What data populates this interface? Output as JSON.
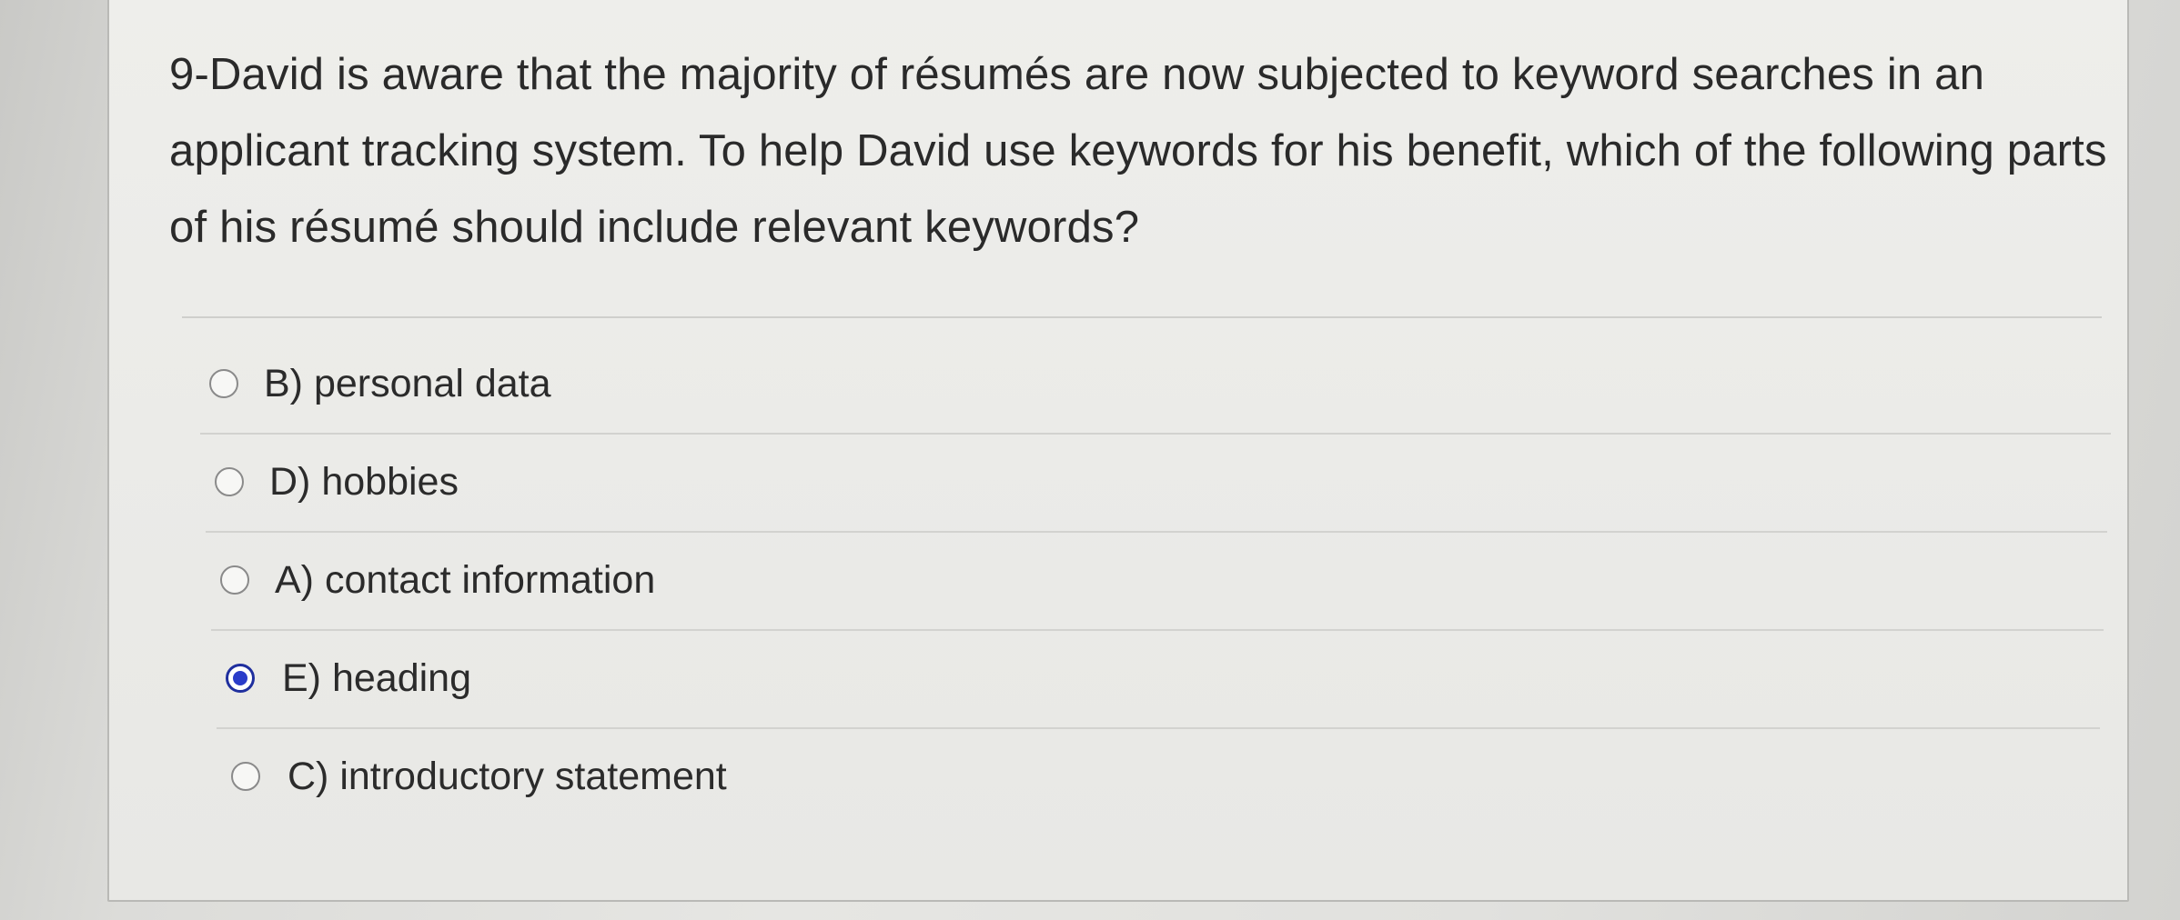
{
  "question": {
    "text": "9-David is aware that the majority of résumés are now subjected to keyword searches in an applicant tracking system. To help David use keywords for his benefit, which of the following parts of his résumé should include relevant keywords?"
  },
  "options": [
    {
      "label": "B) personal data",
      "selected": false
    },
    {
      "label": "D) hobbies",
      "selected": false
    },
    {
      "label": "A) contact information",
      "selected": false
    },
    {
      "label": "E) heading",
      "selected": true
    },
    {
      "label": "C) introductory statement",
      "selected": false
    }
  ],
  "colors": {
    "selected_radio": "#2a3cc9",
    "text": "#2a2a2a"
  }
}
